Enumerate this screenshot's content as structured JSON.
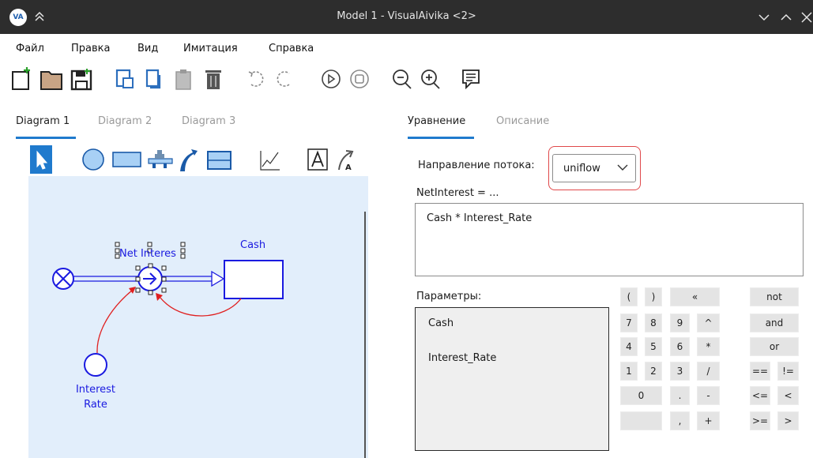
{
  "window": {
    "logo": "VA",
    "title": "Model 1 - VisualAivika <2>"
  },
  "menu": [
    "Файл",
    "Правка",
    "Вид",
    "Имитация",
    "Справка"
  ],
  "toolbar_icons": [
    "new-file-icon",
    "open-folder-icon",
    "save-icon",
    "copy-icon",
    "duplicate-icon",
    "paste-icon",
    "delete-icon",
    "undo-icon",
    "redo-icon",
    "run-icon",
    "stop-icon",
    "zoom-out-icon",
    "zoom-in-icon",
    "comment-icon"
  ],
  "diagram_tabs": [
    {
      "label": "Diagram 1",
      "active": true
    },
    {
      "label": "Diagram 2",
      "active": false
    },
    {
      "label": "Diagram 3",
      "active": false
    }
  ],
  "diagram": {
    "flow_label": "Net Interes",
    "stock_label": "Cash",
    "aux_label_line1": "Interest",
    "aux_label_line2": "Rate"
  },
  "right_tabs": [
    {
      "label": "Уравнение",
      "active": true
    },
    {
      "label": "Описание",
      "active": false
    }
  ],
  "flow_direction": {
    "label": "Направление потока:",
    "value": "uniflow"
  },
  "equation": {
    "label": "NetInterest = ...",
    "value": "Cash * Interest_Rate"
  },
  "parameters": {
    "label": "Параметры:",
    "items": [
      "Cash",
      "Interest_Rate"
    ]
  },
  "keypad": {
    "row1": [
      "(",
      ")",
      "«"
    ],
    "row2": [
      "7",
      "8",
      "9",
      "^"
    ],
    "row3": [
      "4",
      "5",
      "6",
      "*"
    ],
    "row4": [
      "1",
      "2",
      "3",
      "/"
    ],
    "row5": [
      "0",
      ".",
      "-"
    ],
    "row6": [
      "",
      ",",
      "+"
    ],
    "logic": [
      "not",
      "and",
      "or",
      "==",
      "!=",
      "<=",
      "<",
      ">=",
      ">"
    ]
  },
  "colors": {
    "accent": "#1f7acd",
    "diagram_blue": "#1a1ae0",
    "highlight": "#e0484a",
    "canvas": "#e2eefb"
  }
}
